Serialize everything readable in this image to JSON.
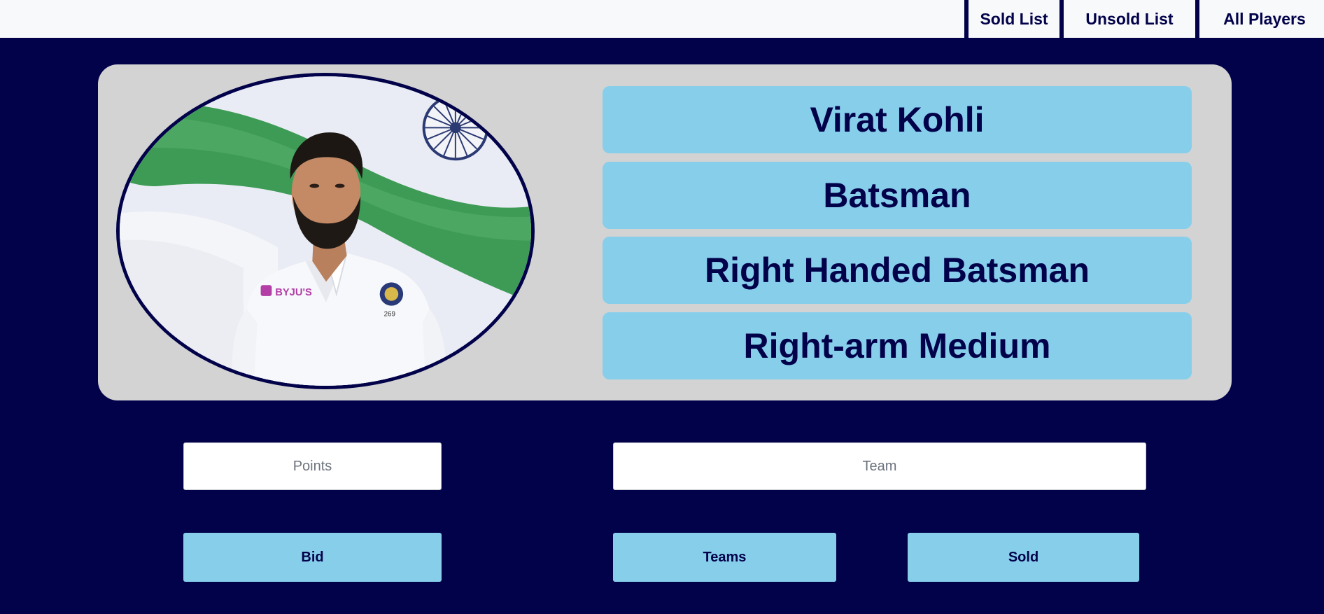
{
  "nav": {
    "items": [
      {
        "label": "Sold List"
      },
      {
        "label": "Unsold List"
      },
      {
        "label": "All Players"
      }
    ]
  },
  "player": {
    "photo_icon": "player-photo",
    "badge_text": "BYJU'S",
    "crest_number": "269",
    "name": "Virat Kohli",
    "role": "Batsman",
    "batting_style": "Right Handed Batsman",
    "bowling_style": "Right-arm Medium"
  },
  "form": {
    "points_placeholder": "Points",
    "team_placeholder": "Team"
  },
  "actions": {
    "bid_label": "Bid",
    "teams_label": "Teams",
    "sold_label": "Sold"
  },
  "colors": {
    "background": "#02024a",
    "card": "#d3d3d3",
    "accent": "#87ceeb",
    "text": "#02024a"
  }
}
